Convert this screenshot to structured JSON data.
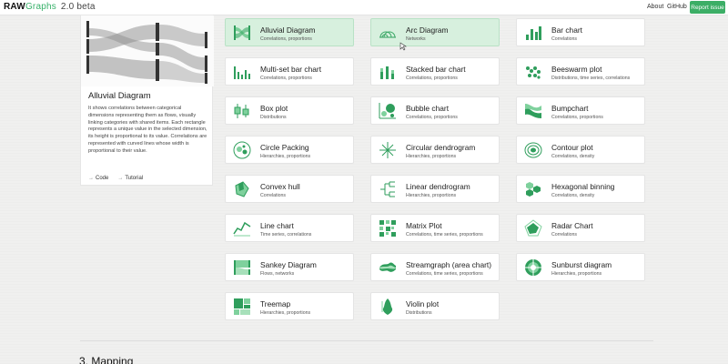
{
  "app": {
    "name_bold": "RAW",
    "name_green": "Graphs",
    "version": "2.0 beta"
  },
  "nav": {
    "about": "About",
    "github": "GitHub",
    "report": "Report issue"
  },
  "preview": {
    "title": "Alluvial Diagram",
    "description": "It shows correlations between categorical dimensions representing them as flows, visually linking categories with shared items. Each rectangle represents a unique value in the selected dimension, its height is proportional to its value. Correlations are represented with curved lines whose width is proportional to their value.",
    "code_link": "Code",
    "tutorial_link": "Tutorial"
  },
  "charts": [
    {
      "name": "Alluvial Diagram",
      "category": "Correlations, proportions",
      "icon": "alluvial-icon",
      "selected": true
    },
    {
      "name": "Arc Diagram",
      "category": "Networks",
      "icon": "arc-icon",
      "selected": true
    },
    {
      "name": "Bar chart",
      "category": "Correlations",
      "icon": "bar-icon"
    },
    {
      "name": "Multi-set bar chart",
      "category": "Correlations, proportions",
      "icon": "multiset-bar-icon"
    },
    {
      "name": "Stacked bar chart",
      "category": "Correlations, proportions",
      "icon": "stacked-bar-icon"
    },
    {
      "name": "Beeswarm plot",
      "category": "Distributions, time series, correlations",
      "icon": "beeswarm-icon"
    },
    {
      "name": "Box plot",
      "category": "Distributions",
      "icon": "boxplot-icon"
    },
    {
      "name": "Bubble chart",
      "category": "Correlations, proportions",
      "icon": "bubble-icon"
    },
    {
      "name": "Bumpchart",
      "category": "Correlations, proportions",
      "icon": "bump-icon"
    },
    {
      "name": "Circle Packing",
      "category": "Hierarchies, proportions",
      "icon": "circle-packing-icon"
    },
    {
      "name": "Circular dendrogram",
      "category": "Hierarchies, proportions",
      "icon": "circular-dendrogram-icon"
    },
    {
      "name": "Contour plot",
      "category": "Correlations, density",
      "icon": "contour-icon"
    },
    {
      "name": "Convex hull",
      "category": "Correlations",
      "icon": "convex-hull-icon"
    },
    {
      "name": "Linear dendrogram",
      "category": "Hierarchies, proportions",
      "icon": "linear-dendrogram-icon"
    },
    {
      "name": "Hexagonal binning",
      "category": "Correlations, density",
      "icon": "hexbin-icon"
    },
    {
      "name": "Line chart",
      "category": "Time series, correlations",
      "icon": "line-chart-icon"
    },
    {
      "name": "Matrix Plot",
      "category": "Correlations, time series, proportions",
      "icon": "matrix-icon"
    },
    {
      "name": "Radar Chart",
      "category": "Correlations",
      "icon": "radar-icon"
    },
    {
      "name": "Sankey Diagram",
      "category": "Flows, networks",
      "icon": "sankey-icon"
    },
    {
      "name": "Streamgraph (area chart)",
      "category": "Correlations, time series, proportions",
      "icon": "streamgraph-icon"
    },
    {
      "name": "Sunburst diagram",
      "category": "Hierarchies, proportions",
      "icon": "sunburst-icon"
    },
    {
      "name": "Treemap",
      "category": "Hierarchies, proportions",
      "icon": "treemap-icon"
    },
    {
      "name": "Violin plot",
      "category": "Distributions",
      "icon": "violin-icon"
    }
  ],
  "sections": {
    "mapping": "3. Mapping"
  },
  "colors": {
    "accent": "#3cae66",
    "selected_bg": "#d7f0de"
  }
}
